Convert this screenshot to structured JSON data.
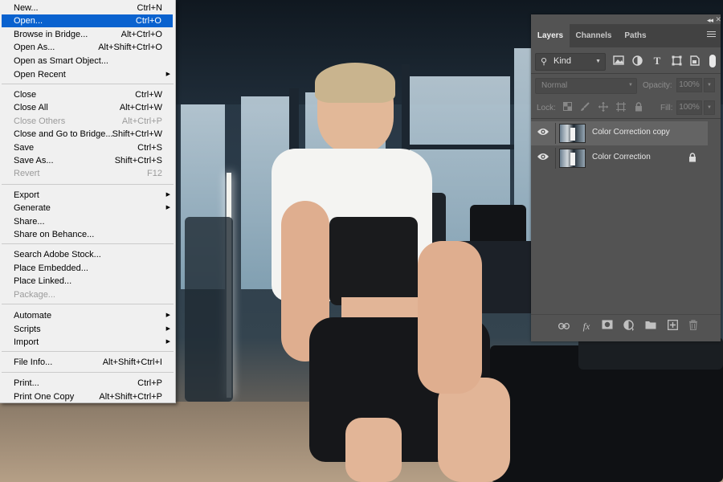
{
  "file_menu": {
    "items": [
      {
        "label": "New...",
        "shortcut": "Ctrl+N",
        "state": "normal"
      },
      {
        "label": "Open...",
        "shortcut": "Ctrl+O",
        "state": "highlighted"
      },
      {
        "label": "Browse in Bridge...",
        "shortcut": "Alt+Ctrl+O",
        "state": "normal"
      },
      {
        "label": "Open As...",
        "shortcut": "Alt+Shift+Ctrl+O",
        "state": "normal"
      },
      {
        "label": "Open as Smart Object...",
        "shortcut": "",
        "state": "normal"
      },
      {
        "label": "Open Recent",
        "shortcut": "",
        "state": "submenu"
      },
      {
        "label": "Close",
        "shortcut": "Ctrl+W",
        "state": "normal"
      },
      {
        "label": "Close All",
        "shortcut": "Alt+Ctrl+W",
        "state": "normal"
      },
      {
        "label": "Close Others",
        "shortcut": "Alt+Ctrl+P",
        "state": "disabled"
      },
      {
        "label": "Close and Go to Bridge...",
        "shortcut": "Shift+Ctrl+W",
        "state": "normal"
      },
      {
        "label": "Save",
        "shortcut": "Ctrl+S",
        "state": "normal"
      },
      {
        "label": "Save As...",
        "shortcut": "Shift+Ctrl+S",
        "state": "normal"
      },
      {
        "label": "Revert",
        "shortcut": "F12",
        "state": "disabled"
      },
      {
        "label": "Export",
        "shortcut": "",
        "state": "submenu"
      },
      {
        "label": "Generate",
        "shortcut": "",
        "state": "submenu"
      },
      {
        "label": "Share...",
        "shortcut": "",
        "state": "normal"
      },
      {
        "label": "Share on Behance...",
        "shortcut": "",
        "state": "normal"
      },
      {
        "label": "Search Adobe Stock...",
        "shortcut": "",
        "state": "normal"
      },
      {
        "label": "Place Embedded...",
        "shortcut": "",
        "state": "normal"
      },
      {
        "label": "Place Linked...",
        "shortcut": "",
        "state": "normal"
      },
      {
        "label": "Package...",
        "shortcut": "",
        "state": "disabled"
      },
      {
        "label": "Automate",
        "shortcut": "",
        "state": "submenu"
      },
      {
        "label": "Scripts",
        "shortcut": "",
        "state": "submenu"
      },
      {
        "label": "Import",
        "shortcut": "",
        "state": "submenu"
      },
      {
        "label": "File Info...",
        "shortcut": "Alt+Shift+Ctrl+I",
        "state": "normal"
      },
      {
        "label": "Print...",
        "shortcut": "Ctrl+P",
        "state": "normal"
      },
      {
        "label": "Print One Copy",
        "shortcut": "Alt+Shift+Ctrl+P",
        "state": "normal"
      }
    ]
  },
  "layers_panel": {
    "tabs": [
      "Layers",
      "Channels",
      "Paths"
    ],
    "active_tab": "Layers",
    "filter_kind": "Kind",
    "blend_mode": "Normal",
    "opacity_label": "Opacity:",
    "opacity_value": "100%",
    "lock_label": "Lock:",
    "fill_label": "Fill:",
    "fill_value": "100%",
    "layers": [
      {
        "name": "Color Correction copy",
        "selected": true,
        "locked": false,
        "visible": true
      },
      {
        "name": "Color Correction",
        "selected": false,
        "locked": true,
        "visible": true
      }
    ]
  },
  "colors": {
    "menu_highlight": "#0a62cf",
    "panel_bg": "#535353",
    "panel_tab_bar": "#424242",
    "selected_layer": "#646464"
  }
}
